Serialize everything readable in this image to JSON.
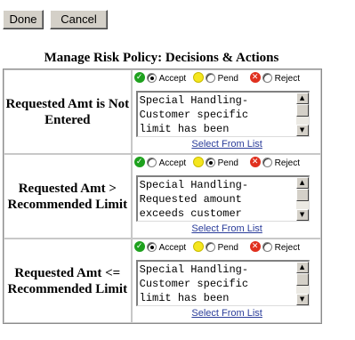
{
  "toolbar": {
    "done_label": "Done",
    "cancel_label": "Cancel"
  },
  "page_title": "Manage Risk Policy: Decisions & Actions",
  "option_labels": {
    "accept": "Accept",
    "pend": "Pend",
    "reject": "Reject"
  },
  "select_link_label": "Select From List",
  "rules": [
    {
      "condition": "Requested Amt is Not Entered",
      "selected": "accept",
      "action_text": "Special Handling-\nCustomer specific\nlimit has been"
    },
    {
      "condition": "Requested Amt > Recommended Limit",
      "selected": "pend",
      "action_text": "Special Handling-\nRequested amount\nexceeds customer"
    },
    {
      "condition": "Requested Amt <= Recommended Limit",
      "selected": "accept",
      "action_text": "Special Handling-\nCustomer specific\nlimit has been"
    }
  ],
  "colors": {
    "accept_icon": "#1ea11e",
    "pend_icon": "#f5e61e",
    "reject_icon": "#e0301e",
    "link": "#2a3c9a"
  },
  "icons": {
    "accept": "check-circle-icon",
    "pend": "yellow-circle-icon",
    "reject": "x-circle-icon"
  }
}
